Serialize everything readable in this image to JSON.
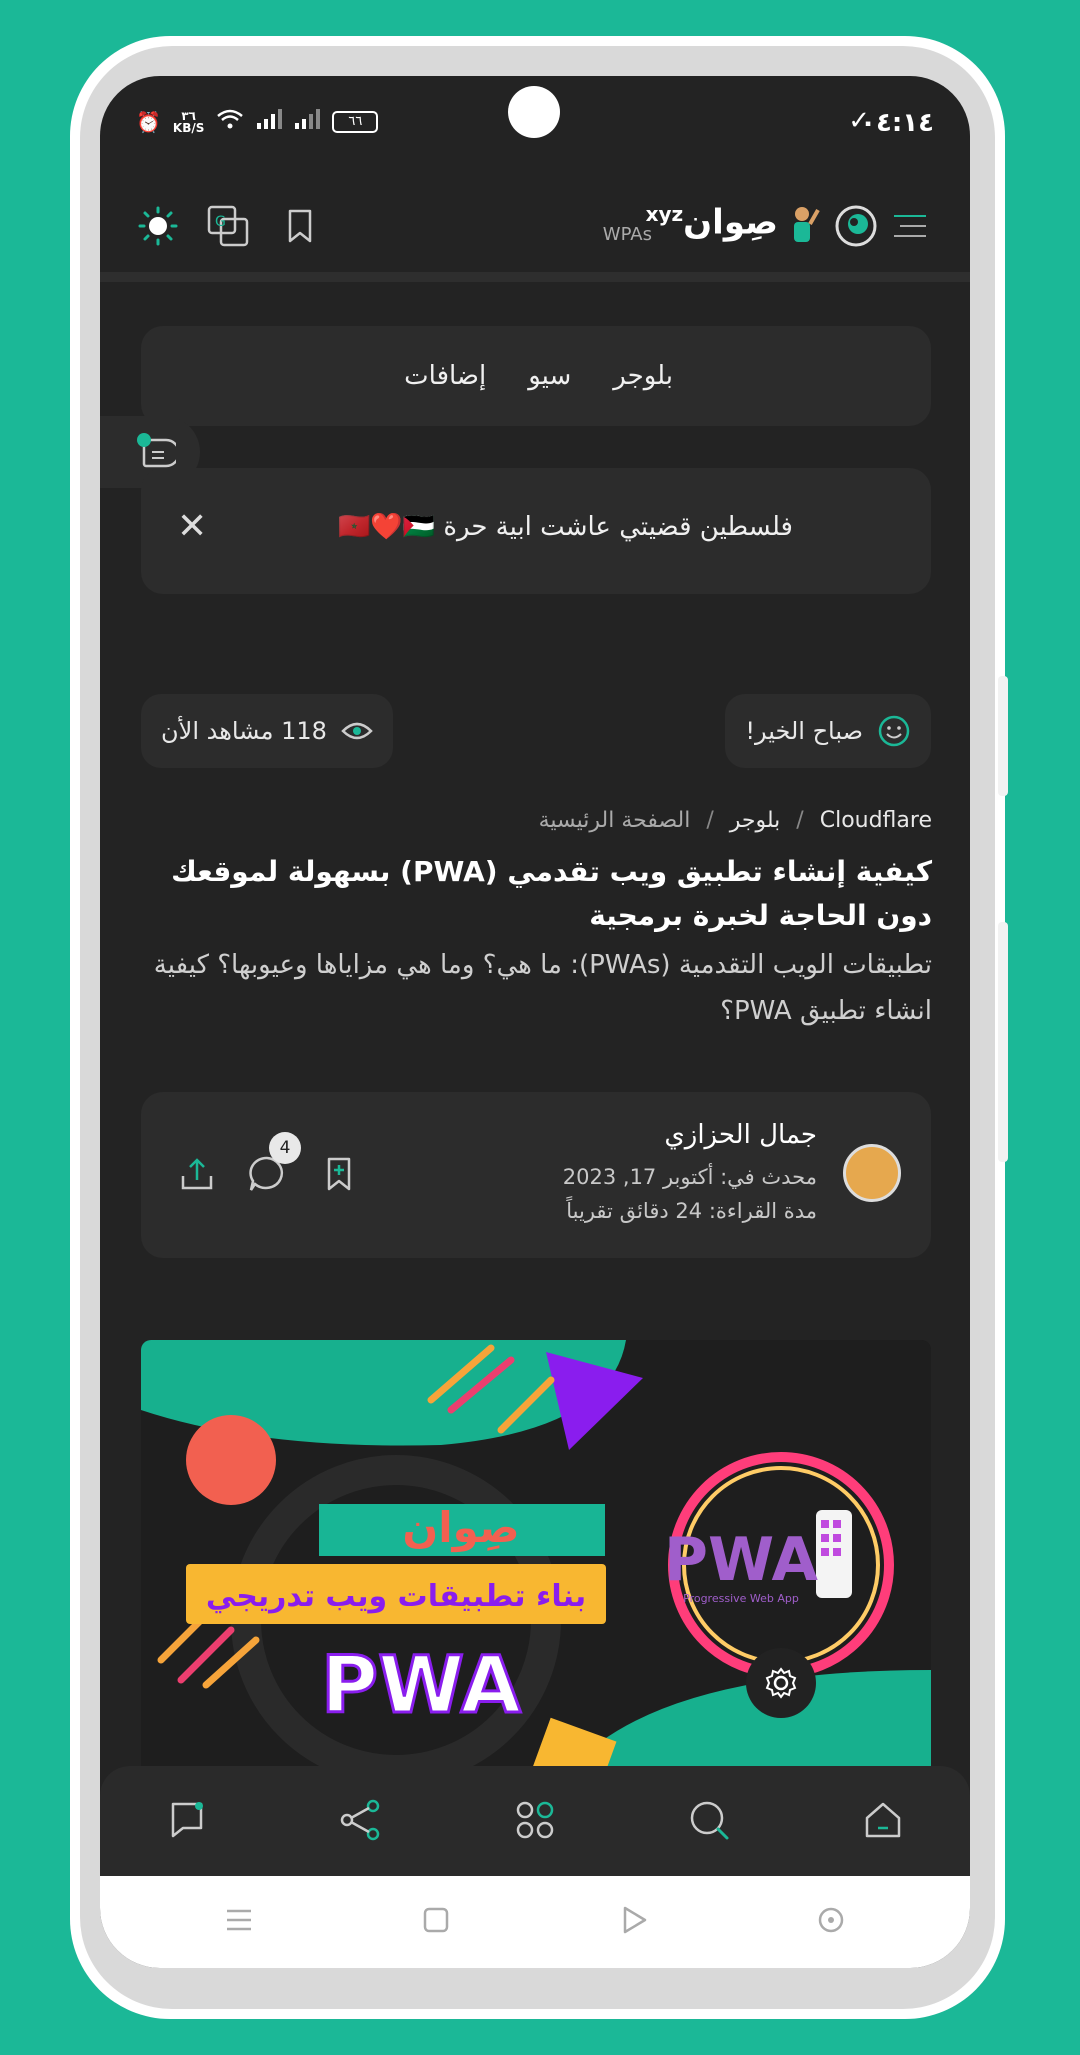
{
  "status_bar": {
    "time": "٠٤:١٤",
    "battery": "٦٦",
    "network_speed_top": "٣٦",
    "network_speed_unit": "KB/S"
  },
  "header": {
    "logo_name": "صِوان",
    "logo_suffix": "xyz",
    "logo_sub": "WPAs"
  },
  "menu": {
    "items": [
      "بلوجر",
      "سيو",
      "إضافات"
    ]
  },
  "notice": {
    "text": "فلسطين قضيتي عاشت ابية حرة 🇲🇦❤️🇵🇸"
  },
  "greeting": {
    "text": "صباح الخير!"
  },
  "views": {
    "text": "118 مشاهد الأن"
  },
  "breadcrumb": {
    "items": [
      "الصفحة الرئيسية",
      "بلوجر",
      "Cloudflare"
    ],
    "separator": "/"
  },
  "article": {
    "title": "كيفية إنشاء تطبيق ويب تقدمي (PWA) بسهولة لموقعك دون الحاجة لخبرة برمجية",
    "summary": "تطبيقات الويب التقدمية (PWAs): ما هي؟ وما هي مزاياها وعيوبها؟ كيفية انشاء تطبيق PWA؟"
  },
  "author": {
    "name": "جمال الحزازي",
    "updated": "محدث في: أكتوبر 17, 2023",
    "reading_time": "مدة القراءة: 24 دقائق تقريباً",
    "comments_count": "4"
  },
  "banner": {
    "brand": "صِوان",
    "headline": "بناء تطبيقات ويب تدريجي",
    "pwa_main": "PWA",
    "pwa_side": "PWA",
    "pwa_side_caption": "Progressive Web App"
  },
  "colors": {
    "accent": "#1bb897",
    "background": "#232323",
    "card": "#2c2c2c"
  }
}
